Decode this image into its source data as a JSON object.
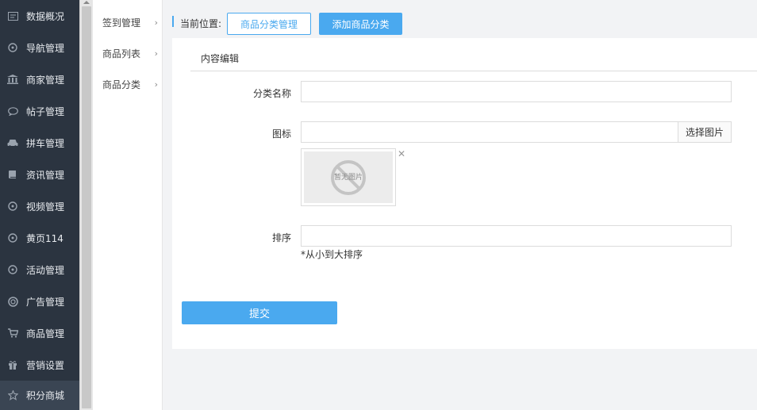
{
  "sidebar": {
    "items": [
      {
        "label": "数据概况",
        "icon": "dashboard-icon"
      },
      {
        "label": "导航管理",
        "icon": "compass-icon"
      },
      {
        "label": "商家管理",
        "icon": "bank-icon"
      },
      {
        "label": "帖子管理",
        "icon": "comment-icon"
      },
      {
        "label": "拼车管理",
        "icon": "car-icon"
      },
      {
        "label": "资讯管理",
        "icon": "book-icon"
      },
      {
        "label": "视频管理",
        "icon": "compass-icon"
      },
      {
        "label": "黄页114",
        "icon": "compass-icon"
      },
      {
        "label": "活动管理",
        "icon": "compass-icon"
      },
      {
        "label": "广告管理",
        "icon": "lifebuoy-icon"
      },
      {
        "label": "商品管理",
        "icon": "cart-icon"
      },
      {
        "label": "营销设置",
        "icon": "gift-icon"
      },
      {
        "label": "积分商城",
        "icon": "star-icon"
      }
    ],
    "active_index": 12
  },
  "submenu": {
    "items": [
      {
        "label": "签到管理"
      },
      {
        "label": "商品列表"
      },
      {
        "label": "商品分类"
      }
    ]
  },
  "breadcrumb": {
    "label": "当前位置:",
    "btn_manage": "商品分类管理",
    "btn_add": "添加商品分类"
  },
  "panel": {
    "tab": "内容编辑",
    "name_label": "分类名称",
    "name_value": "",
    "icon_label": "图标",
    "icon_value": "",
    "select_image": "选择图片",
    "no_image": "暂无图片",
    "close_glyph": "✕",
    "sort_label": "排序",
    "sort_value": "",
    "sort_hint": "*从小到大排序",
    "submit": "提交"
  },
  "colors": {
    "sidebar_bg": "#2b3440",
    "accent": "#4aa9ef"
  }
}
